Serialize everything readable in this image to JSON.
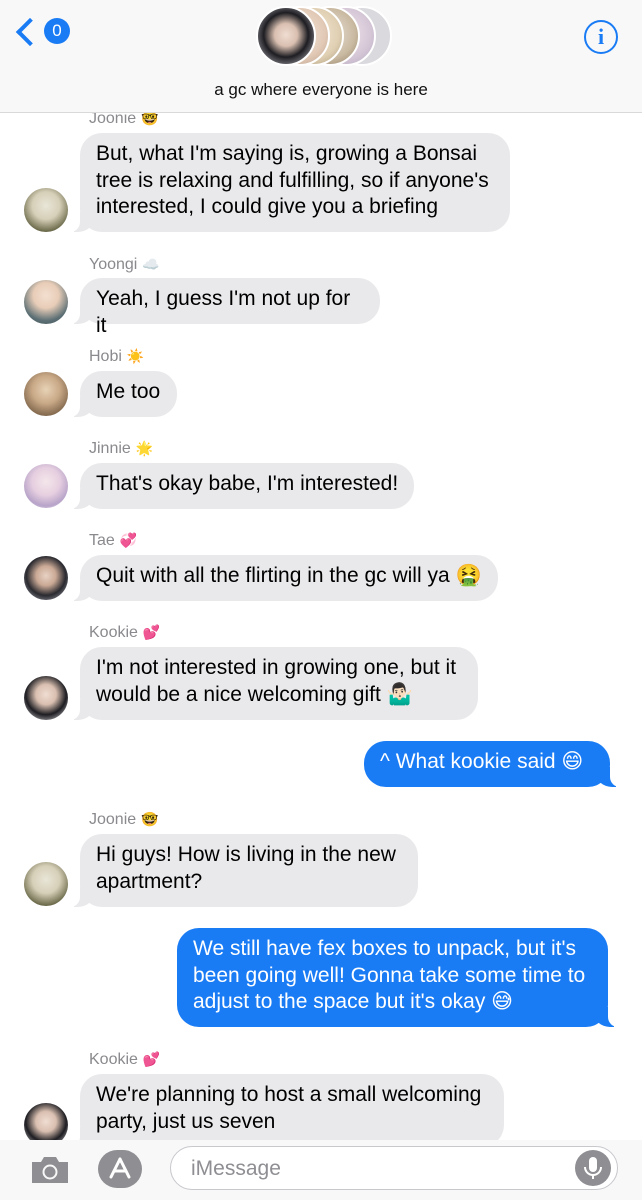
{
  "header": {
    "back_badge": "0",
    "title": "a gc where everyone is here",
    "info_glyph": "i"
  },
  "colors": {
    "accent": "#1a7cf5",
    "incoming_bubble": "#e9e9eb",
    "outgoing_bubble": "#1a7cf5",
    "sender_name": "#8a8a8e"
  },
  "messages": [
    {
      "sender": "Joonie",
      "emoji": "🤓",
      "text": "But, what I'm saying is, growing a Bonsai\ntree is relaxing and fulfilling, so if anyone's\ninterested, I could give you a briefing"
    },
    {
      "sender": "Yoongi",
      "emoji": "☁️",
      "text": "Yeah, I guess I'm not up for it"
    },
    {
      "sender": "Hobi",
      "emoji": "☀️",
      "text": "Me too"
    },
    {
      "sender": "Jinnie",
      "emoji": "🌟",
      "text": "That's okay babe, I'm interested!"
    },
    {
      "sender": "Tae",
      "emoji": "💞",
      "text": "Quit with all the flirting in the gc will ya 🤮"
    },
    {
      "sender": "Kookie",
      "emoji": "💕",
      "text": "I'm not interested in growing one, but it\nwould be a nice welcoming gift 🤷🏻‍♂️"
    },
    {
      "sender": "",
      "emoji": "",
      "text": "^ What kookie said 😄"
    },
    {
      "sender": "Joonie",
      "emoji": "🤓",
      "text": "Hi guys! How is living in the new\napartment?"
    },
    {
      "sender": "",
      "emoji": "",
      "text": "We still have fex boxes to unpack, but it's\nbeen going well! Gonna take some time to\nadjust to the space but it's okay 😅"
    },
    {
      "sender": "Kookie",
      "emoji": "💕",
      "text": "We're planning to host a small welcoming\nparty, just us seven"
    }
  ],
  "composer": {
    "placeholder": "iMessage"
  }
}
